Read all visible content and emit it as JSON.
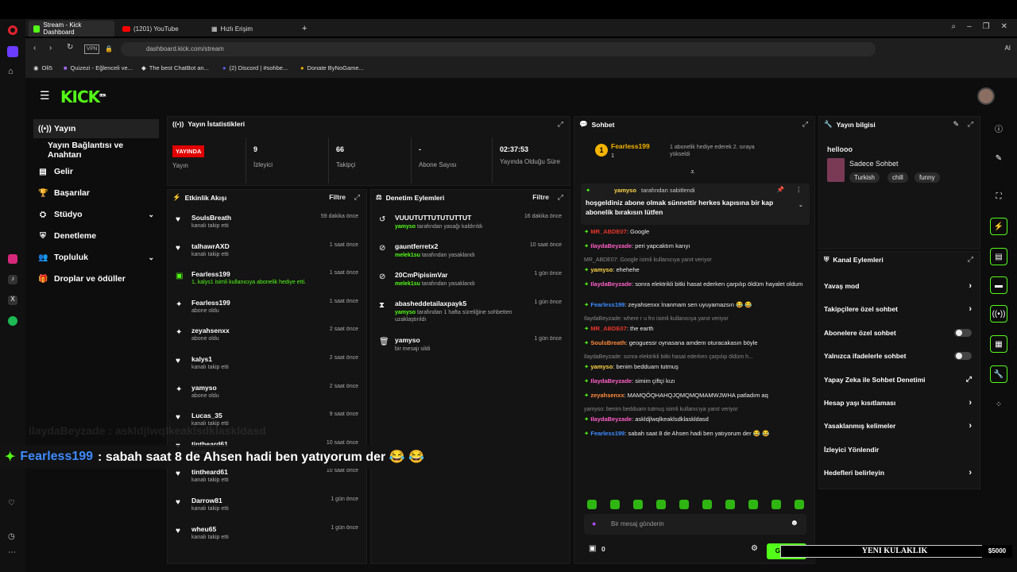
{
  "browser": {
    "tabs": [
      {
        "label": "Stream - Kick Dashboard",
        "icon": "kick-icon",
        "active": true
      },
      {
        "label": "(1201) YouTube",
        "icon": "youtube-icon",
        "active": false
      },
      {
        "label": "Hızlı Erişim",
        "icon": "grid-icon",
        "active": false
      }
    ],
    "url": "dashboard.kick.com/stream",
    "vpn": "VPN",
    "ai": "AI",
    "bookmarks": [
      "Oli5",
      "Quizezi - Eğlenceli ve...",
      "The best ChatBot an...",
      "(2) Discord | #sohbe...",
      "Donate ByNoGame..."
    ]
  },
  "logo": "KICK",
  "logo_beta": "BETA",
  "nav": {
    "items": [
      {
        "label": "Yayın",
        "icon": "broadcast-icon"
      },
      {
        "label": "Yayın Bağlantısı ve Anahtarı",
        "icon": ""
      },
      {
        "label": "Gelir",
        "icon": "money-icon"
      },
      {
        "label": "Başarılar",
        "icon": "trophy-icon"
      },
      {
        "label": "Stüdyo",
        "icon": "studio-icon"
      },
      {
        "label": "Denetleme",
        "icon": "shield-icon"
      },
      {
        "label": "Topluluk",
        "icon": "community-icon"
      },
      {
        "label": "Droplar ve ödüller",
        "icon": "gift-icon"
      }
    ]
  },
  "stats": {
    "title": "Yayın İstatistikleri",
    "live": "YAYINDA",
    "live_label": "Yayın",
    "viewers": "9",
    "viewers_label": "İzleyici",
    "followers": "66",
    "followers_label": "Takipçi",
    "subs": "-",
    "subs_label": "Abone Sayısı",
    "uptime": "02:37:53",
    "uptime_label": "Yayında Olduğu Süre"
  },
  "activity": {
    "title": "Etkinlik Akışı",
    "filter": "Filtre",
    "items": [
      {
        "name": "SoulsBreath",
        "sub": "kanalı takip etti",
        "time": "59 dakika önce",
        "icon": "heart"
      },
      {
        "name": "talhawrAXD",
        "sub": "kanalı takip etti",
        "time": "1 saat önce",
        "icon": "heart"
      },
      {
        "name": "Fearless199",
        "sub": "1, kalys1 isimli kullanıcıya abonelik hediye etti.",
        "time": "1 saat önce",
        "icon": "gift"
      },
      {
        "name": "Fearless199",
        "sub": "abone oldu",
        "time": "1 saat önce",
        "icon": "star"
      },
      {
        "name": "zeyahsenxx",
        "sub": "abone oldu",
        "time": "2 saat önce",
        "icon": "star"
      },
      {
        "name": "kalys1",
        "sub": "kanalı takip etti",
        "time": "2 saat önce",
        "icon": "heart"
      },
      {
        "name": "yamyso",
        "sub": "abone oldu",
        "time": "2 saat önce",
        "icon": "star"
      },
      {
        "name": "Lucas_35",
        "sub": "kanalı takip etti",
        "time": "9 saat önce",
        "icon": "heart"
      },
      {
        "name": "tintheard61",
        "sub": "kanalı takip etti",
        "time": "10 saat önce",
        "icon": "heart"
      },
      {
        "name": "tintheard61",
        "sub": "kanalı takip etti",
        "time": "10 saat önce",
        "icon": "heart"
      },
      {
        "name": "Darrow81",
        "sub": "kanalı takip etti",
        "time": "1 gün önce",
        "icon": "heart"
      },
      {
        "name": "wheu65",
        "sub": "kanalı takip etti",
        "time": "1 gün önce",
        "icon": "heart"
      }
    ]
  },
  "moderation": {
    "title": "Denetim Eylemleri",
    "filter": "Filtre",
    "items": [
      {
        "name": "VUUUTUTTUTUTUTTUT",
        "by": "yamyso",
        "sub": " tarafından yasağı kaldırıldı",
        "time": "16 dakika önce",
        "icon": "undo"
      },
      {
        "name": "gauntferretx2",
        "by": "melek1su",
        "sub": " tarafından yasaklandı",
        "time": "10 saat önce",
        "icon": "ban"
      },
      {
        "name": "20CmPipisimVar",
        "by": "melek1su",
        "sub": " tarafından yasaklandı",
        "time": "1 gün önce",
        "icon": "ban"
      },
      {
        "name": "abasheddetailaxpayk5",
        "by": "yamyso",
        "sub": " tarafından 1 hafta süreliğine sohbetten uzaklaştırıldı",
        "time": "1 gün önce",
        "icon": "hourglass"
      },
      {
        "name": "yamyso",
        "by": "",
        "sub": "bir mesajı sildi",
        "time": "1 gün önce",
        "icon": "trash"
      }
    ]
  },
  "chat": {
    "title": "Sohbet",
    "top_user": "Fearless199",
    "top_count": "1",
    "gift_note": "1 abonelik hediye ederek 2. sıraya yükseldi",
    "pinned_by": "yamyso",
    "pinned_label": "tarafından sabitlendi",
    "pinned_text": "hoşgeldiniz abone olmak sünnettir herkes kapısına bir kap abonelik bırakısın lütfen",
    "messages": [
      {
        "user": "MR_ABDE07",
        "text": ": Google",
        "color": "#e8352b",
        "reply": false
      },
      {
        "user": "IlaydaBeyzade",
        "text": ": peri yapcaktım karıyı",
        "color": "#ff5fc8",
        "reply": false
      },
      {
        "user": "",
        "text": "MR_ABDE07: Google isimli kullanıcıya yanıt veriyor",
        "color": "",
        "reply": true
      },
      {
        "user": "yamyso",
        "text": ": ehehehe",
        "color": "#ffd54a",
        "reply": false
      },
      {
        "user": "IlaydaBeyzade",
        "text": ": sonra elektrikli bitki hasat ederken çarpılıp öldüm hayalet oldum",
        "color": "#ff5fc8",
        "reply": false
      },
      {
        "user": "Fearless199",
        "text": ": zeyahsenxx İnanmam sen uyuyamazsın 😂 😂",
        "color": "#3d8bff",
        "reply": false
      },
      {
        "user": "",
        "text": "IlaydaBeyzade: where r u fro isimli kullanıcıya yanıt veriyor",
        "color": "",
        "reply": true
      },
      {
        "user": "MR_ABDE07",
        "text": ": the earth",
        "color": "#e8352b",
        "reply": false
      },
      {
        "user": "SoulsBreath",
        "text": ": geoguessr oynasana amdem oturacakasın böyle",
        "color": "#ff8a3d",
        "reply": false
      },
      {
        "user": "",
        "text": "IlaydaBeyzade: sonra elektrikli bitki hasat ederken çarpılıp öldüm h...",
        "color": "",
        "reply": true
      },
      {
        "user": "yamyso",
        "text": ": benim bedduam tutmuş",
        "color": "#ffd54a",
        "reply": false
      },
      {
        "user": "IlaydaBeyzade",
        "text": ": simim çiftçi kızı",
        "color": "#ff5fc8",
        "reply": false
      },
      {
        "user": "zeyahsenxx",
        "text": ": MAMQÖQHAHQJQMQMQMAMWJWHA patladım aq",
        "color": "#ff8a3d",
        "reply": false
      },
      {
        "user": "",
        "text": "yamyso: benim bedduam tutmuş isimli kullanıcıya yanıt veriyor",
        "color": "",
        "reply": true
      },
      {
        "user": "IlaydaBeyzade",
        "text": ": askldjlwqlkeaklsdklaskldasd",
        "color": "#ff5fc8",
        "reply": false
      },
      {
        "user": "Fearless199",
        "text": ": sabah saat 8 de Ahsen hadi ben yatıyorum der 😂 😂",
        "color": "#3d8bff",
        "reply": false
      }
    ],
    "input_placeholder": "Bir mesaj gönderin",
    "points": "0",
    "send": "Gönder"
  },
  "streaminfo": {
    "title": "Yayın bilgisi",
    "stream_title": "hellooo",
    "category": "Sadece Sohbet",
    "tags": [
      "Turkish",
      "chill",
      "funny"
    ]
  },
  "channel_actions": {
    "title": "Kanal Eylemleri",
    "items": [
      {
        "label": "Yavaş mod",
        "type": "arrow"
      },
      {
        "label": "Takipçilere özel sohbet",
        "type": "arrow"
      },
      {
        "label": "Abonelere özel sohbet",
        "type": "toggle"
      },
      {
        "label": "Yalnızca ifadelerle sohbet",
        "type": "toggle"
      },
      {
        "label": "Yapay Zeka ile Sohbet Denetimi",
        "type": "ext"
      },
      {
        "label": "Hesap yaşı kısıtlaması",
        "type": "arrow"
      },
      {
        "label": "Yasaklanmış kelimeler",
        "type": "arrow"
      },
      {
        "label": "İzleyici Yönlendir",
        "type": "none"
      },
      {
        "label": "Hedefleri belirleyin",
        "type": "arrow"
      }
    ]
  },
  "overlay": {
    "user": "Fearless199",
    "text": ": sabah saat 8 de Ahsen hadi ben yatıyorum der 😂 😂",
    "ghost_text": "IlaydaBeyzade : askldjlwqlkeaklsdklaskldasd"
  },
  "yt_bar": {
    "text": "YENI KULAKLIK",
    "price": "$5000"
  },
  "colors": {
    "accent": "#53fc18",
    "live": "#e10000",
    "panel": "#141414"
  }
}
